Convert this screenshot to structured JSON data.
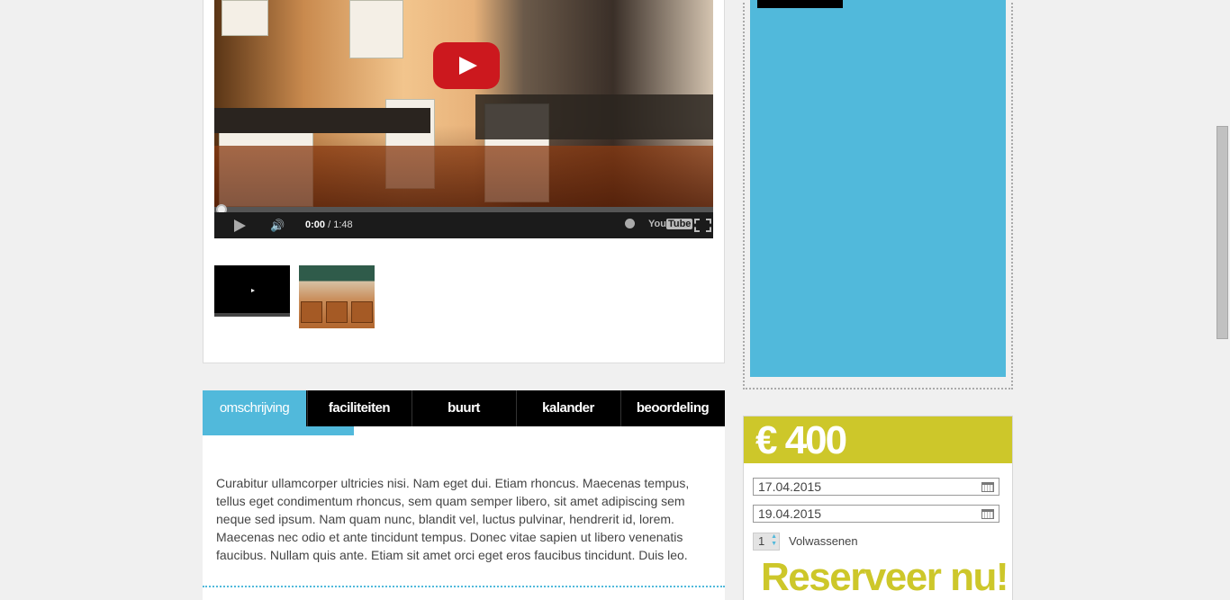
{
  "video": {
    "time_current": "0:00",
    "time_sep": " / ",
    "time_total": "1:48",
    "youtube_label": "You",
    "youtube_tube": "Tube"
  },
  "tabs": [
    {
      "label": "omschrijving",
      "active": true
    },
    {
      "label": "faciliteiten"
    },
    {
      "label": "buurt"
    },
    {
      "label": "kalander"
    },
    {
      "label": "beoordeling"
    }
  ],
  "description": "Curabitur ullamcorper ultricies nisi. Nam eget dui. Etiam rhoncus. Maecenas tempus, tellus eget condimentum rhoncus, sem quam semper libero, sit amet adipiscing sem neque sed ipsum. Nam quam nunc, blandit vel, luctus pulvinar, hendrerit id, lorem. Maecenas nec odio et ante tincidunt tempus. Donec vitae sapien ut libero venenatis faucibus. Nullam quis ante. Etiam sit amet orci eget eros faucibus tincidunt. Duis leo.",
  "booking": {
    "price": "€ 400",
    "date_from": "17.04.2015",
    "date_to": "19.04.2015",
    "guests_value": "1",
    "guests_label": "Volwassenen",
    "reserve_label": "Reserveer nu!"
  },
  "colors": {
    "accent_blue": "#51b9db",
    "accent_lime": "#cdc72a",
    "youtube_red": "#cc181e"
  }
}
